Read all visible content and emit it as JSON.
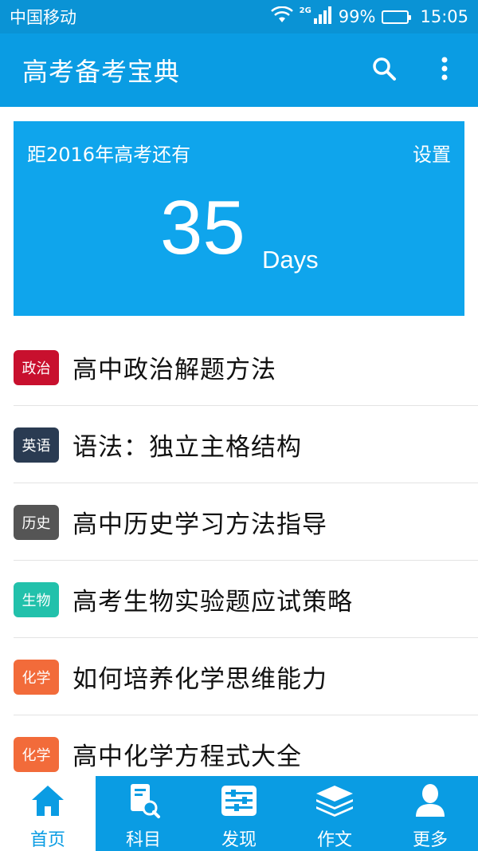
{
  "status_bar": {
    "carrier": "中国移动",
    "network": "2G",
    "battery": "99%",
    "time": "15:05"
  },
  "app_bar": {
    "title": "高考备考宝典"
  },
  "countdown": {
    "label": "距2016年高考还有",
    "settings": "设置",
    "days_value": "35",
    "days_unit": "Days"
  },
  "articles": [
    {
      "tag": "政治",
      "tag_color": "#c8102e",
      "title": "高中政治解题方法"
    },
    {
      "tag": "英语",
      "tag_color": "#2a3b52",
      "title": "语法：独立主格结构"
    },
    {
      "tag": "历史",
      "tag_color": "#555555",
      "title": "高中历史学习方法指导"
    },
    {
      "tag": "生物",
      "tag_color": "#22c1ab",
      "title": "高考生物实验题应试策略"
    },
    {
      "tag": "化学",
      "tag_color": "#f26b3a",
      "title": "如何培养化学思维能力"
    },
    {
      "tag": "化学",
      "tag_color": "#f26b3a",
      "title": "高中化学方程式大全"
    }
  ],
  "bottom_nav": [
    {
      "label": "首页",
      "icon": "home-icon",
      "active": true
    },
    {
      "label": "科目",
      "icon": "subject-book-search-icon",
      "active": false
    },
    {
      "label": "发现",
      "icon": "discover-sliders-icon",
      "active": false
    },
    {
      "label": "作文",
      "icon": "essay-layers-icon",
      "active": false
    },
    {
      "label": "更多",
      "icon": "user-icon",
      "active": false
    }
  ],
  "colors": {
    "primary": "#0a9ce3",
    "status_bar": "#0a93d5",
    "card": "#0fa5ec"
  }
}
